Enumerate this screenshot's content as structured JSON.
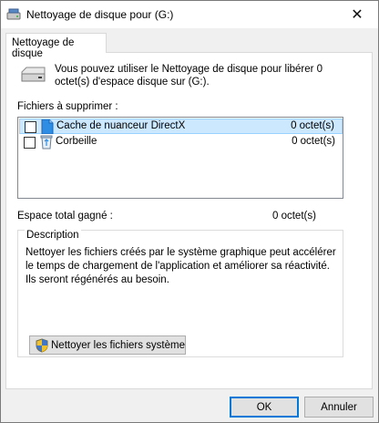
{
  "window": {
    "title": "Nettoyage de disque pour  (G:)",
    "close_glyph": "✕"
  },
  "tab": {
    "label": "Nettoyage de disque"
  },
  "intro": {
    "text": "Vous pouvez utiliser le Nettoyage de disque pour libérer 0 octet(s) d'espace disque sur  (G:).",
    "icon": "drive-icon"
  },
  "files": {
    "label": "Fichiers à supprimer :",
    "items": [
      {
        "name": "Cache de nuanceur DirectX",
        "size": "0 octet(s)",
        "checked": false,
        "selected": true,
        "icon": "file-icon"
      },
      {
        "name": "Corbeille",
        "size": "0 octet(s)",
        "checked": false,
        "selected": false,
        "icon": "recycle-bin-icon"
      }
    ]
  },
  "total": {
    "label": "Espace total gagné :",
    "value": "0 octet(s)"
  },
  "description": {
    "legend": "Description",
    "text": "Nettoyer les fichiers créés par le système graphique peut accélérer le temps de chargement de l'application et améliorer sa réactivité. Ils seront régénérés au besoin."
  },
  "buttons": {
    "system_files": "Nettoyer les fichiers système",
    "ok": "OK",
    "cancel": "Annuler"
  },
  "colors": {
    "selection": "#cce8ff",
    "accent": "#0078d7"
  }
}
